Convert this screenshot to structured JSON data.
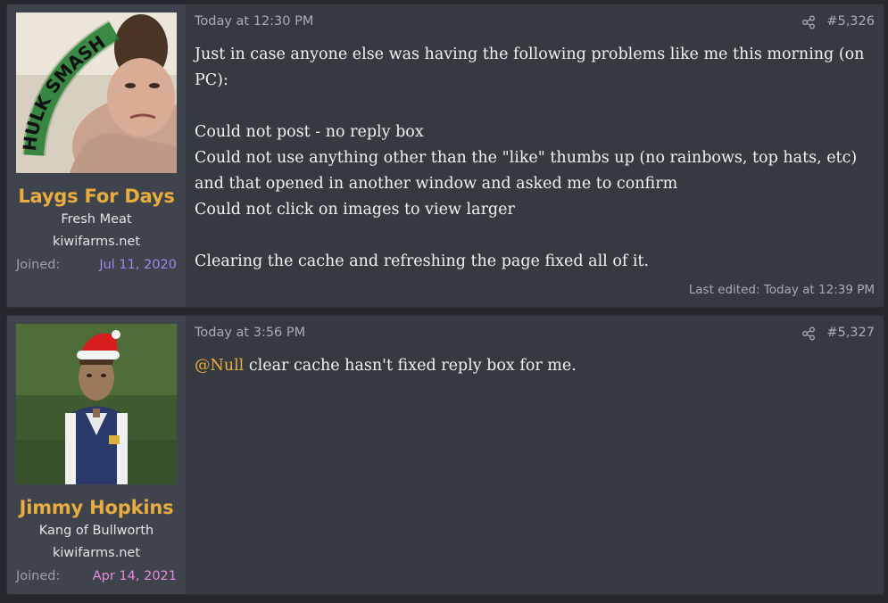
{
  "posts": [
    {
      "username": "Laygs For Days",
      "user_title": "Fresh Meat",
      "site": "kiwifarms.net",
      "joined_label": "Joined:",
      "joined_date": "Jul 11, 2020",
      "joined_color": "#9f87f0",
      "avatar_text": "HULK SMASH",
      "date": "Today at 12:30 PM",
      "number": "#5,326",
      "lines": [
        "Just in case anyone else was having the following problems like me this morning (on PC):",
        "",
        "Could not post - no reply box",
        "Could not use anything other than the \"like\" thumbs up (no rainbows, top hats, etc) and that opened in another window and asked me to confirm",
        "Could not click on images to view larger",
        "",
        "Clearing the cache and refreshing the page fixed all of it."
      ],
      "edited": "Last edited: Today at 12:39 PM"
    },
    {
      "username": "Jimmy Hopkins",
      "user_title": "Kang of Bullworth",
      "site": "kiwifarms.net",
      "joined_label": "Joined:",
      "joined_date": "Apr 14, 2021",
      "joined_color": "#e58ce0",
      "date": "Today at 3:56 PM",
      "number": "#5,327",
      "mention": "@Null",
      "text": " clear cache hasn't fixed reply box for me."
    }
  ]
}
